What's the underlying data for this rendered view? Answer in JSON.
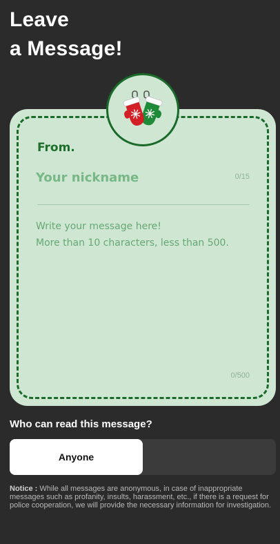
{
  "page": {
    "title_line1": "Leave",
    "title_line2": "a Message!"
  },
  "badge": {
    "icon": "mittens-icon"
  },
  "form": {
    "from_label": "From.",
    "nickname": {
      "value": "",
      "placeholder": "Your nickname",
      "counter": "0/15"
    },
    "message": {
      "value": "",
      "placeholder": "Write your message here!\nMore than 10 characters, less than 500.",
      "counter": "0/500"
    }
  },
  "visibility": {
    "label": "Who can read this message?",
    "options": [
      {
        "label": "Anyone",
        "selected": true
      },
      {
        "label": "",
        "selected": false
      }
    ]
  },
  "notice": {
    "title": "Notice :",
    "text": "While all messages are anonymous, in case of inappropriate messages such as profanity, insults, harassment, etc., if there is a request for police cooperation, we will provide the necessary information for investigation."
  },
  "colors": {
    "background": "#2b2b2b",
    "card": "#cfe6d2",
    "accent": "#1a6a2a",
    "mitten_red": "#d32027",
    "mitten_green": "#1f8a37"
  }
}
